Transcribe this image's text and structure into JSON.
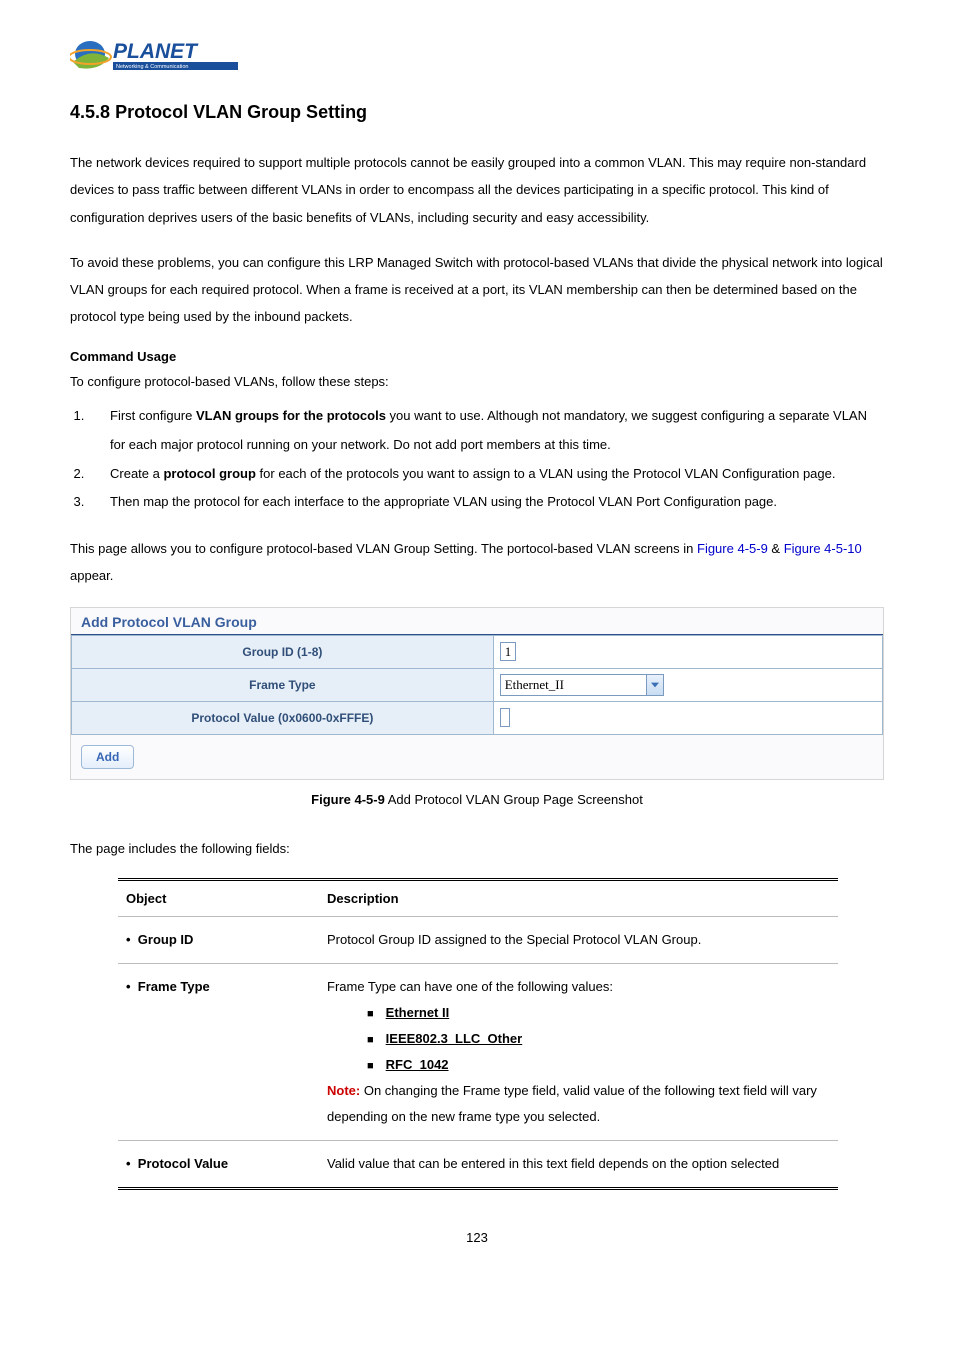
{
  "logo": {
    "brand_text": "PLANET",
    "tagline": "Networking & Communication"
  },
  "header": {
    "section_number": "4.5.8",
    "section_title": "Protocol VLAN Group Setting"
  },
  "paragraphs": {
    "p1": "The network devices required to support multiple protocols cannot be easily grouped into a common VLAN. This may require non-standard devices to pass traffic between different VLANs in order to encompass all the devices participating in a specific protocol. This kind of configuration deprives users of the basic benefits of VLANs, including security and easy accessibility.",
    "p2": "To avoid these problems, you can configure this LRP Managed Switch with protocol-based VLANs that divide the physical network into logical VLAN groups for each required protocol. When a frame is received at a port, its VLAN membership can then be determined based on the protocol type being used by the inbound packets.",
    "cmd_heading": "Command Usage",
    "cmd_intro": "To configure protocol-based VLANs, follow these steps:",
    "steps": {
      "s1_pre": "First configure ",
      "s1_bold": "VLAN groups for the protocols",
      "s1_post": " you want to use. Although not mandatory, we suggest configuring a separate VLAN for each major protocol running on your network. Do not add port members at this time.",
      "s2_pre": "Create a ",
      "s2_bold": "protocol group",
      "s2_post": " for each of the protocols you want to assign to a VLAN using the Protocol VLAN Configuration page.",
      "s3": "Then map the protocol for each interface to the appropriate VLAN using the Protocol VLAN Port Configuration page."
    },
    "link_para_pre": "This page allows you to configure protocol-based VLAN Group Setting. The portocol-based VLAN screens in ",
    "link1": "Figure 4-5-9",
    "link_para_mid": " & ",
    "link2": "Figure 4-5-10",
    "link_para_post": " appear."
  },
  "figure": {
    "title": "Add Protocol VLAN Group",
    "rows": {
      "group_id_label": "Group ID (1-8)",
      "group_id_value": "1",
      "frame_type_label": "Frame Type",
      "frame_type_value": "Ethernet_II",
      "protocol_value_label": "Protocol Value (0x0600-0xFFFE)",
      "protocol_value_value": ""
    },
    "add_btn": "Add"
  },
  "caption": {
    "bold": "Figure 4-5-9",
    "rest": " Add Protocol VLAN Group Page Screenshot"
  },
  "fields_intro": "The page includes the following fields:",
  "desc_table": {
    "head_obj": "Object",
    "head_desc": "Description",
    "rows": [
      {
        "obj": "Group ID",
        "desc_plain": "Protocol Group ID assigned to the Special Protocol VLAN Group."
      },
      {
        "obj": "Frame Type",
        "desc_intro": "Frame Type can have one of the following values:",
        "items": [
          "Ethernet II",
          "IEEE802.3_LLC_Other",
          "RFC_1042"
        ],
        "note_label": "Note:",
        "note_rest": " On changing the Frame type field, valid value of the following text field will vary depending on the new frame type you selected."
      },
      {
        "obj": "Protocol Value",
        "desc_plain": "Valid value that can be entered in this text field depends on the option selected"
      }
    ]
  },
  "page_number": "123"
}
